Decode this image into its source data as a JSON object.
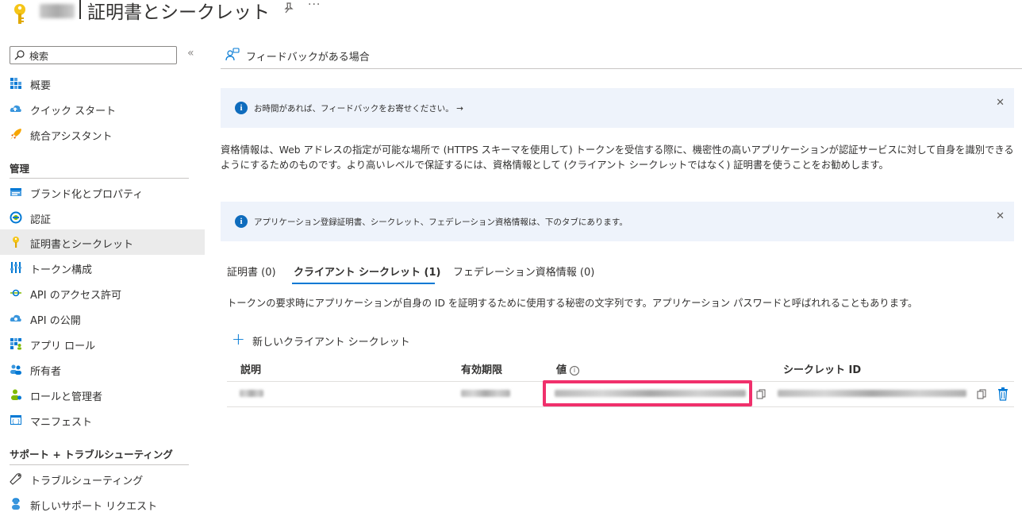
{
  "header": {
    "title": "証明書とシークレット",
    "more": "···"
  },
  "sidebar": {
    "search_placeholder": "検索",
    "collapse": "«",
    "items_top": [
      {
        "label": "概要",
        "icon": "overview-icon"
      },
      {
        "label": "クイック スタート",
        "icon": "cloud-quickstart-icon"
      },
      {
        "label": "統合アシスタント",
        "icon": "rocket-icon"
      }
    ],
    "section_manage": "管理",
    "items_manage": [
      {
        "label": "ブランド化とプロパティ",
        "icon": "branding-icon"
      },
      {
        "label": "認証",
        "icon": "authentication-icon"
      },
      {
        "label": "証明書とシークレット",
        "icon": "key-icon",
        "active": true
      },
      {
        "label": "トークン構成",
        "icon": "token-config-icon"
      },
      {
        "label": "API のアクセス許可",
        "icon": "api-permissions-icon"
      },
      {
        "label": "API の公開",
        "icon": "expose-api-icon"
      },
      {
        "label": "アプリ ロール",
        "icon": "app-roles-icon"
      },
      {
        "label": "所有者",
        "icon": "owners-icon"
      },
      {
        "label": "ロールと管理者",
        "icon": "roles-admins-icon"
      },
      {
        "label": "マニフェスト",
        "icon": "manifest-icon"
      }
    ],
    "section_support": "サポート + トラブルシューティング",
    "items_support": [
      {
        "label": "トラブルシューティング",
        "icon": "wrench-icon"
      },
      {
        "label": "新しいサポート リクエスト",
        "icon": "support-person-icon"
      }
    ]
  },
  "main": {
    "feedback_label": "フィードバックがある場合",
    "banner1": "お時間があれば、フィードバックをお寄せください。 →",
    "banner2": "アプリケーション登録証明書、シークレット、フェデレーション資格情報は、下のタブにあります。",
    "close": "✕",
    "description": "資格情報は、Web アドレスの指定が可能な場所で (HTTPS スキーマを使用して) トークンを受信する際に、機密性の高いアプリケーションが認証サービスに対して自身を識別できるようにするためのものです。より高いレベルで保証するには、資格情報として (クライアント シークレットではなく) 証明書を使うことをお勧めします。",
    "tabs": [
      "証明書 (0)",
      "クライアント シークレット (1)",
      "フェデレーション資格情報 (0)"
    ],
    "active_tab": 1,
    "tab_description": "トークンの要求時にアプリケーションが自身の ID を証明するために使用する秘密の文字列です。アプリケーション パスワードと呼ばれれることもあります。",
    "add_button": "新しいクライアント シークレット",
    "columns": [
      "説明",
      "有効期限",
      "値",
      "シークレット ID"
    ],
    "info_glyph": "i",
    "highlight_color": "#f0306c",
    "accent_color": "#0078d4"
  }
}
